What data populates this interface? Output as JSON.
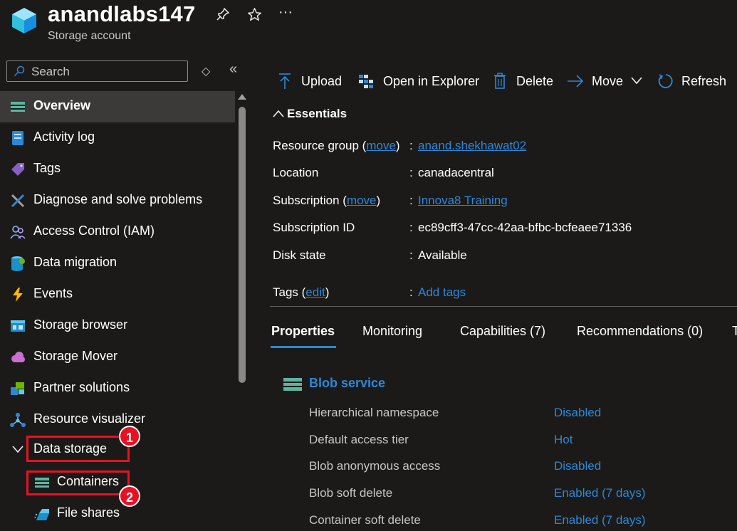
{
  "header": {
    "title": "anandlabs147",
    "subtitle": "Storage account",
    "pin_icon": "pin-icon",
    "star_icon": "star-icon",
    "more_icon": "more-icon",
    "more_glyph": "···"
  },
  "search": {
    "placeholder": "Search",
    "value": ""
  },
  "sidebar_controls": {
    "expand_glyph": "◇",
    "collapse_glyph": "«"
  },
  "sidebar": {
    "items": [
      {
        "label": "Overview",
        "icon": "overview-icon",
        "selected": true
      },
      {
        "label": "Activity log",
        "icon": "activity-log-icon"
      },
      {
        "label": "Tags",
        "icon": "tag-icon"
      },
      {
        "label": "Diagnose and solve problems",
        "icon": "wrench-icon"
      },
      {
        "label": "Access Control (IAM)",
        "icon": "people-icon"
      },
      {
        "label": "Data migration",
        "icon": "data-migration-icon"
      },
      {
        "label": "Events",
        "icon": "lightning-icon"
      },
      {
        "label": "Storage browser",
        "icon": "storage-browser-icon"
      },
      {
        "label": "Storage Mover",
        "icon": "cloud-icon"
      },
      {
        "label": "Partner solutions",
        "icon": "partner-icon"
      },
      {
        "label": "Resource visualizer",
        "icon": "network-icon"
      }
    ],
    "group": {
      "label": "Data storage",
      "icon": "chevron-down-icon",
      "expanded": true
    },
    "sub_items": [
      {
        "label": "Containers",
        "icon": "container-icon"
      },
      {
        "label": "File shares",
        "icon": "file-share-icon"
      }
    ]
  },
  "annotations": {
    "badge1": "1",
    "badge2": "2"
  },
  "toolbar": {
    "upload": "Upload",
    "open_explorer": "Open in Explorer",
    "delete": "Delete",
    "move": "Move",
    "refresh": "Refresh"
  },
  "essentials": {
    "title": "Essentials",
    "resource_group": {
      "key": "Resource group (",
      "link": "move",
      "close": ")",
      "value": "anand.shekhawat02"
    },
    "location": {
      "key": "Location",
      "value": "canadacentral"
    },
    "subscription": {
      "key": "Subscription (",
      "link": "move",
      "close": ")",
      "value": "Innova8 Training"
    },
    "subscription_id": {
      "key": "Subscription ID",
      "value": "ec89cff3-47cc-42aa-bfbc-bcfeaee71336"
    },
    "disk_state": {
      "key": "Disk state",
      "value": "Available"
    },
    "tags": {
      "key": "Tags (",
      "link": "edit",
      "close": ")",
      "value": "Add tags"
    },
    "colon": ":"
  },
  "tabs": [
    "Properties",
    "Monitoring",
    "Capabilities (7)",
    "Recommendations (0)",
    "T"
  ],
  "blob_service": {
    "title": "Blob service",
    "rows": [
      {
        "key": "Hierarchical namespace",
        "value": "Disabled"
      },
      {
        "key": "Default access tier",
        "value": "Hot"
      },
      {
        "key": "Blob anonymous access",
        "value": "Disabled"
      },
      {
        "key": "Blob soft delete",
        "value": "Enabled (7 days)"
      },
      {
        "key": "Container soft delete",
        "value": "Enabled (7 days)"
      }
    ]
  },
  "colors": {
    "accent": "#2b88d8",
    "highlight": "#e81123",
    "selected_bg": "#3b3a39"
  }
}
